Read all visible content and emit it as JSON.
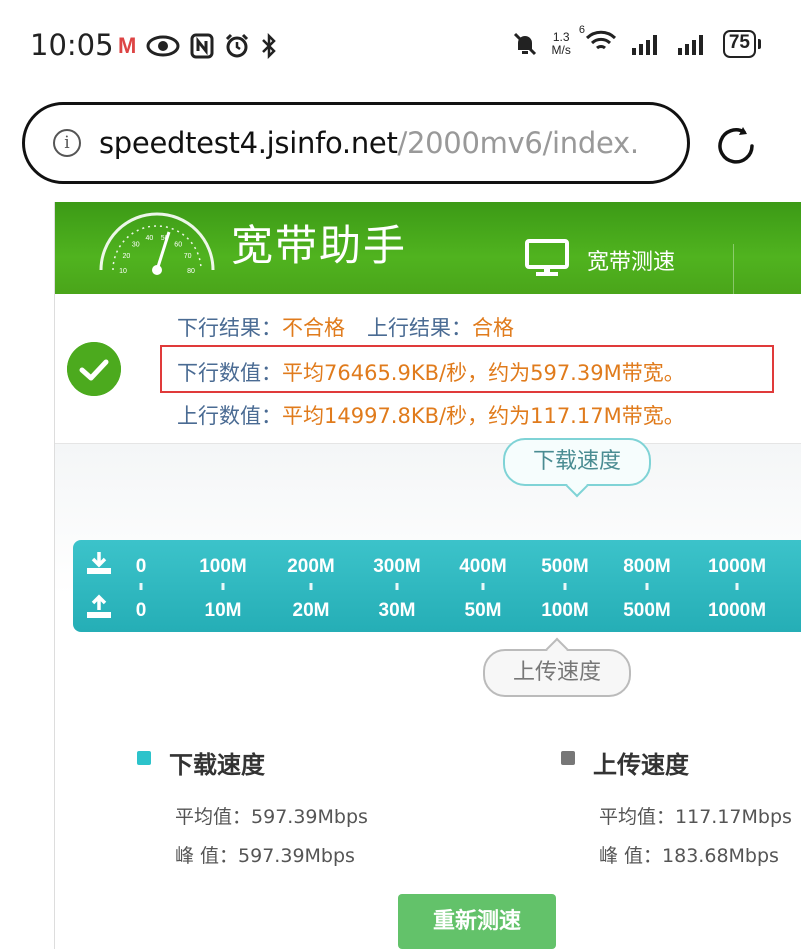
{
  "status_bar": {
    "time": "10:05",
    "gmail": "M",
    "net_speed_value": "1.3",
    "net_speed_unit": "M/s",
    "wifi_label": "6",
    "battery": "75"
  },
  "url_bar": {
    "host": "speedtest4.jsinfo.net",
    "path": "/2000mv6/index."
  },
  "header": {
    "title": "宽带助手",
    "nav_label": "宽带测速",
    "gauge_ticks": [
      "10",
      "20",
      "30",
      "40",
      "50",
      "60",
      "70",
      "80"
    ]
  },
  "results": {
    "down_result_label": "下行结果：",
    "down_result_value": "不合格",
    "up_result_label": "上行结果：",
    "up_result_value": "合格",
    "down_value_label": "下行数值：",
    "down_value_text": "平均76465.9KB/秒，约为597.39M带宽。",
    "up_value_label": "上行数值：",
    "up_value_text": "平均14997.8KB/秒，约为117.17M带宽。"
  },
  "scale": {
    "download_bubble": "下载速度",
    "upload_bubble": "上传速度",
    "download_ticks": [
      "0",
      "100M",
      "200M",
      "300M",
      "400M",
      "500M",
      "800M",
      "1000M"
    ],
    "upload_ticks": [
      "0",
      "10M",
      "20M",
      "30M",
      "50M",
      "100M",
      "500M",
      "1000M"
    ]
  },
  "summary": {
    "download": {
      "title": "下载速度",
      "avg_label": "平均值：",
      "avg_value": "597.39Mbps",
      "peak_label": "峰 值：",
      "peak_value": "597.39Mbps",
      "color": "#2cc3cb"
    },
    "upload": {
      "title": "上传速度",
      "avg_label": "平均值：",
      "avg_value": "117.17Mbps",
      "peak_label": "峰 值：",
      "peak_value": "183.68Mbps",
      "color": "#777777"
    }
  },
  "retest_button": "重新测速",
  "colors": {
    "header_green": "#4aa51a",
    "label_blue": "#4a6b93",
    "value_orange": "#e07b1c",
    "highlight_red": "#e03a3a",
    "scale_teal": "#2cb5bd",
    "button_green": "#63c26a"
  }
}
